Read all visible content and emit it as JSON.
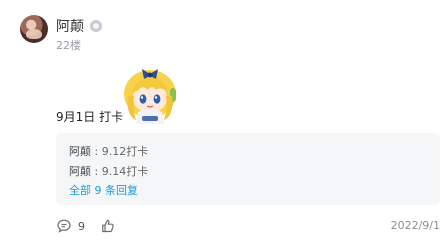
{
  "user": {
    "name": "阿颠",
    "floor": "22楼"
  },
  "post": {
    "text": "9月1日 打卡"
  },
  "replies": [
    {
      "name": "阿颠",
      "sep": " : ",
      "text": "9.12打卡"
    },
    {
      "name": "阿颠",
      "sep": " : ",
      "text": "9.14打卡"
    }
  ],
  "reply_summary": {
    "label": "全部 9 条回复"
  },
  "footer": {
    "comment_count": "9",
    "date": "2022/9/1"
  },
  "icons": {
    "comment": "comment-icon",
    "like": "thumbs-up-icon",
    "badge": "user-badge-icon"
  },
  "colors": {
    "link": "#1e9bd7",
    "muted": "#9aa0a6",
    "panel": "#f5f6f7"
  }
}
